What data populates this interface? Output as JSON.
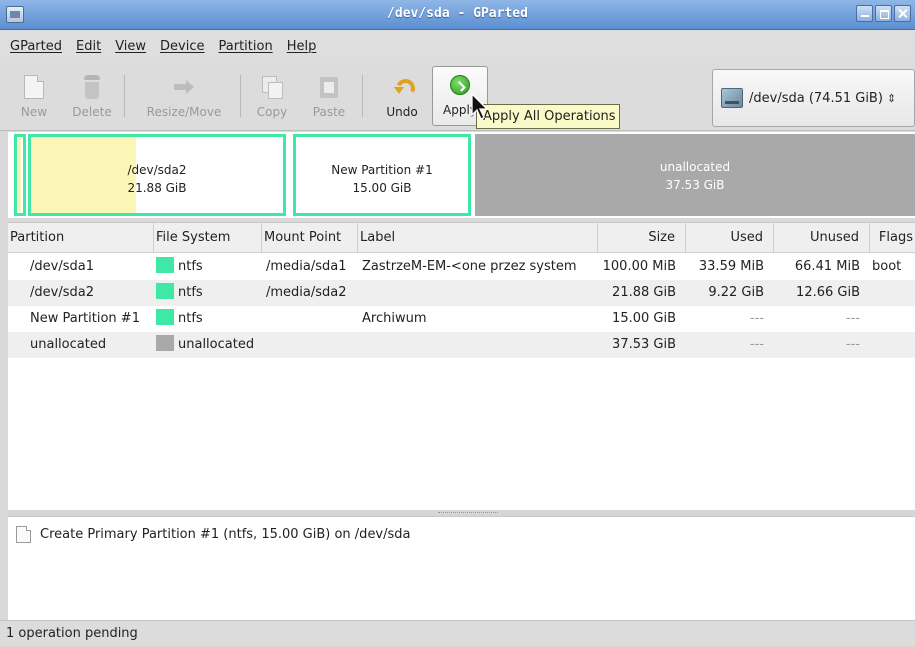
{
  "window": {
    "title": "/dev/sda - GParted"
  },
  "menu": [
    "GParted",
    "Edit",
    "View",
    "Device",
    "Partition",
    "Help"
  ],
  "toolbar": {
    "new": "New",
    "delete": "Delete",
    "resize_move": "Resize/Move",
    "copy": "Copy",
    "paste": "Paste",
    "undo": "Undo",
    "apply": "Apply",
    "apply_tooltip": "Apply All Operations"
  },
  "device": {
    "label": "/dev/sda  (74.51 GiB)"
  },
  "diskmap": {
    "sda2": {
      "name": "/dev/sda2",
      "size": "21.88 GiB"
    },
    "new": {
      "name": "New Partition #1",
      "size": "15.00 GiB"
    },
    "unalloc": {
      "name": "unallocated",
      "size": "37.53 GiB"
    }
  },
  "table": {
    "headers": {
      "partition": "Partition",
      "fs": "File System",
      "mount": "Mount Point",
      "label": "Label",
      "size": "Size",
      "used": "Used",
      "unused": "Unused",
      "flags": "Flags"
    },
    "rows": [
      {
        "partition": "/dev/sda1",
        "fs": "ntfs",
        "fs_color": "#3fe8a4",
        "mount": "/media/sda1",
        "label": "ZastrzeM-EM-<one przez system",
        "size": "100.00 MiB",
        "used": "33.59 MiB",
        "unused": "66.41 MiB",
        "flags": "boot"
      },
      {
        "partition": "/dev/sda2",
        "fs": "ntfs",
        "fs_color": "#3fe8a4",
        "mount": "/media/sda2",
        "label": "",
        "size": "21.88 GiB",
        "used": "9.22 GiB",
        "unused": "12.66 GiB",
        "flags": ""
      },
      {
        "partition": "New Partition #1",
        "fs": "ntfs",
        "fs_color": "#3fe8a4",
        "mount": "",
        "label": "Archiwum",
        "size": "15.00 GiB",
        "used": "---",
        "unused": "---",
        "flags": ""
      },
      {
        "partition": "unallocated",
        "fs": "unallocated",
        "fs_color": "#a9a9a9",
        "mount": "",
        "label": "",
        "size": "37.53 GiB",
        "used": "---",
        "unused": "---",
        "flags": ""
      }
    ]
  },
  "operations": [
    "Create Primary Partition #1 (ntfs, 15.00 GiB) on /dev/sda"
  ],
  "status": "1 operation pending"
}
